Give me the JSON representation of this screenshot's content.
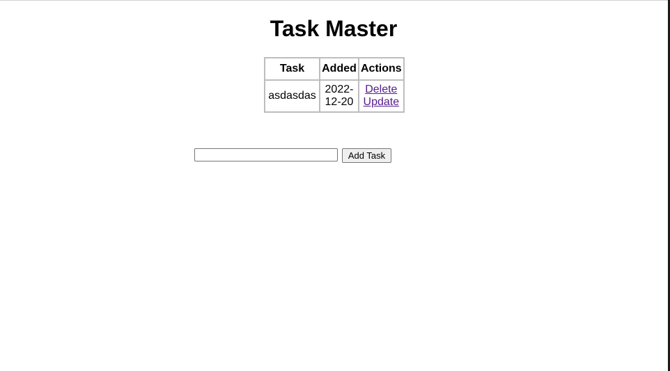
{
  "page": {
    "title": "Task Master"
  },
  "table": {
    "headers": [
      "Task",
      "Added",
      "Actions"
    ],
    "rows": [
      {
        "task": "asdasdas",
        "added_line1": "2022-",
        "added_line2": "12-20",
        "delete_label": "Delete",
        "update_label": "Update"
      }
    ]
  },
  "form": {
    "input_value": "",
    "input_placeholder": "",
    "submit_label": "Add Task"
  },
  "colors": {
    "link_visited": "#551a8b",
    "table_border": "#bdbdbd",
    "button_bg": "#efefef"
  }
}
